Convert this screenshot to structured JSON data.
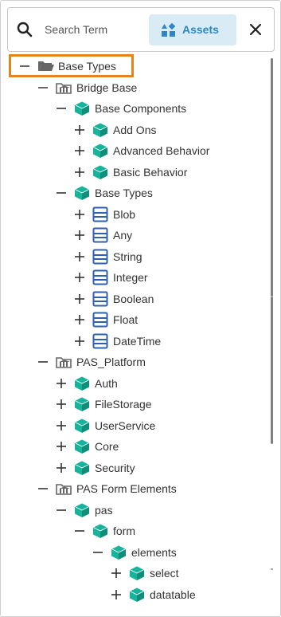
{
  "search": {
    "placeholder": "Search Term"
  },
  "assets_button": {
    "label": "Assets"
  },
  "colors": {
    "accent": "#2f86c4",
    "assets_bg": "#d9ecf6",
    "selection_outline": "#e8821a",
    "cube": "#17b39a",
    "type_icon": "#2d5fb5",
    "folder": "#666666"
  },
  "tree": [
    {
      "id": "base-types-root",
      "label": "Base Types",
      "icon": "folder-open-icon",
      "toggle": "minus",
      "depth": 0,
      "selected": true
    },
    {
      "id": "bridge-base",
      "label": "Bridge Base",
      "icon": "library-icon",
      "toggle": "minus",
      "depth": 1
    },
    {
      "id": "base-components",
      "label": "Base Components",
      "icon": "cube-icon",
      "toggle": "minus",
      "depth": 2
    },
    {
      "id": "add-ons",
      "label": "Add Ons",
      "icon": "cube-icon",
      "toggle": "plus",
      "depth": 3
    },
    {
      "id": "advanced-behavior",
      "label": "Advanced Behavior",
      "icon": "cube-icon",
      "toggle": "plus",
      "depth": 3
    },
    {
      "id": "basic-behavior",
      "label": "Basic Behavior",
      "icon": "cube-icon",
      "toggle": "plus",
      "depth": 3
    },
    {
      "id": "base-types",
      "label": "Base Types",
      "icon": "cube-icon",
      "toggle": "minus",
      "depth": 2
    },
    {
      "id": "blob",
      "label": "Blob",
      "icon": "type-icon",
      "toggle": "plus",
      "depth": 3
    },
    {
      "id": "any",
      "label": "Any",
      "icon": "type-icon",
      "toggle": "plus",
      "depth": 3
    },
    {
      "id": "string",
      "label": "String",
      "icon": "type-icon",
      "toggle": "plus",
      "depth": 3
    },
    {
      "id": "integer",
      "label": "Integer",
      "icon": "type-icon",
      "toggle": "plus",
      "depth": 3
    },
    {
      "id": "boolean",
      "label": "Boolean",
      "icon": "type-icon",
      "toggle": "plus",
      "depth": 3
    },
    {
      "id": "float",
      "label": "Float",
      "icon": "type-icon",
      "toggle": "plus",
      "depth": 3
    },
    {
      "id": "datetime",
      "label": "DateTime",
      "icon": "type-icon",
      "toggle": "plus",
      "depth": 3
    },
    {
      "id": "pas-platform",
      "label": "PAS_Platform",
      "icon": "library-icon",
      "toggle": "minus",
      "depth": 1
    },
    {
      "id": "auth",
      "label": "Auth",
      "icon": "cube-icon",
      "toggle": "plus",
      "depth": 2
    },
    {
      "id": "filestorage",
      "label": "FileStorage",
      "icon": "cube-icon",
      "toggle": "plus",
      "depth": 2
    },
    {
      "id": "userservice",
      "label": "UserService",
      "icon": "cube-icon",
      "toggle": "plus",
      "depth": 2
    },
    {
      "id": "core",
      "label": "Core",
      "icon": "cube-icon",
      "toggle": "plus",
      "depth": 2
    },
    {
      "id": "security",
      "label": "Security",
      "icon": "cube-icon",
      "toggle": "plus",
      "depth": 2
    },
    {
      "id": "pas-form-elements",
      "label": "PAS Form Elements",
      "icon": "library-icon",
      "toggle": "minus",
      "depth": 1
    },
    {
      "id": "pas",
      "label": "pas",
      "icon": "cube-icon",
      "toggle": "minus",
      "depth": 2
    },
    {
      "id": "form",
      "label": "form",
      "icon": "cube-icon",
      "toggle": "minus",
      "depth": 3
    },
    {
      "id": "elements",
      "label": "elements",
      "icon": "cube-icon",
      "toggle": "minus",
      "depth": 4
    },
    {
      "id": "select",
      "label": "select",
      "icon": "cube-icon",
      "toggle": "plus",
      "depth": 5
    },
    {
      "id": "datatable",
      "label": "datatable",
      "icon": "cube-icon",
      "toggle": "plus",
      "depth": 5
    }
  ]
}
